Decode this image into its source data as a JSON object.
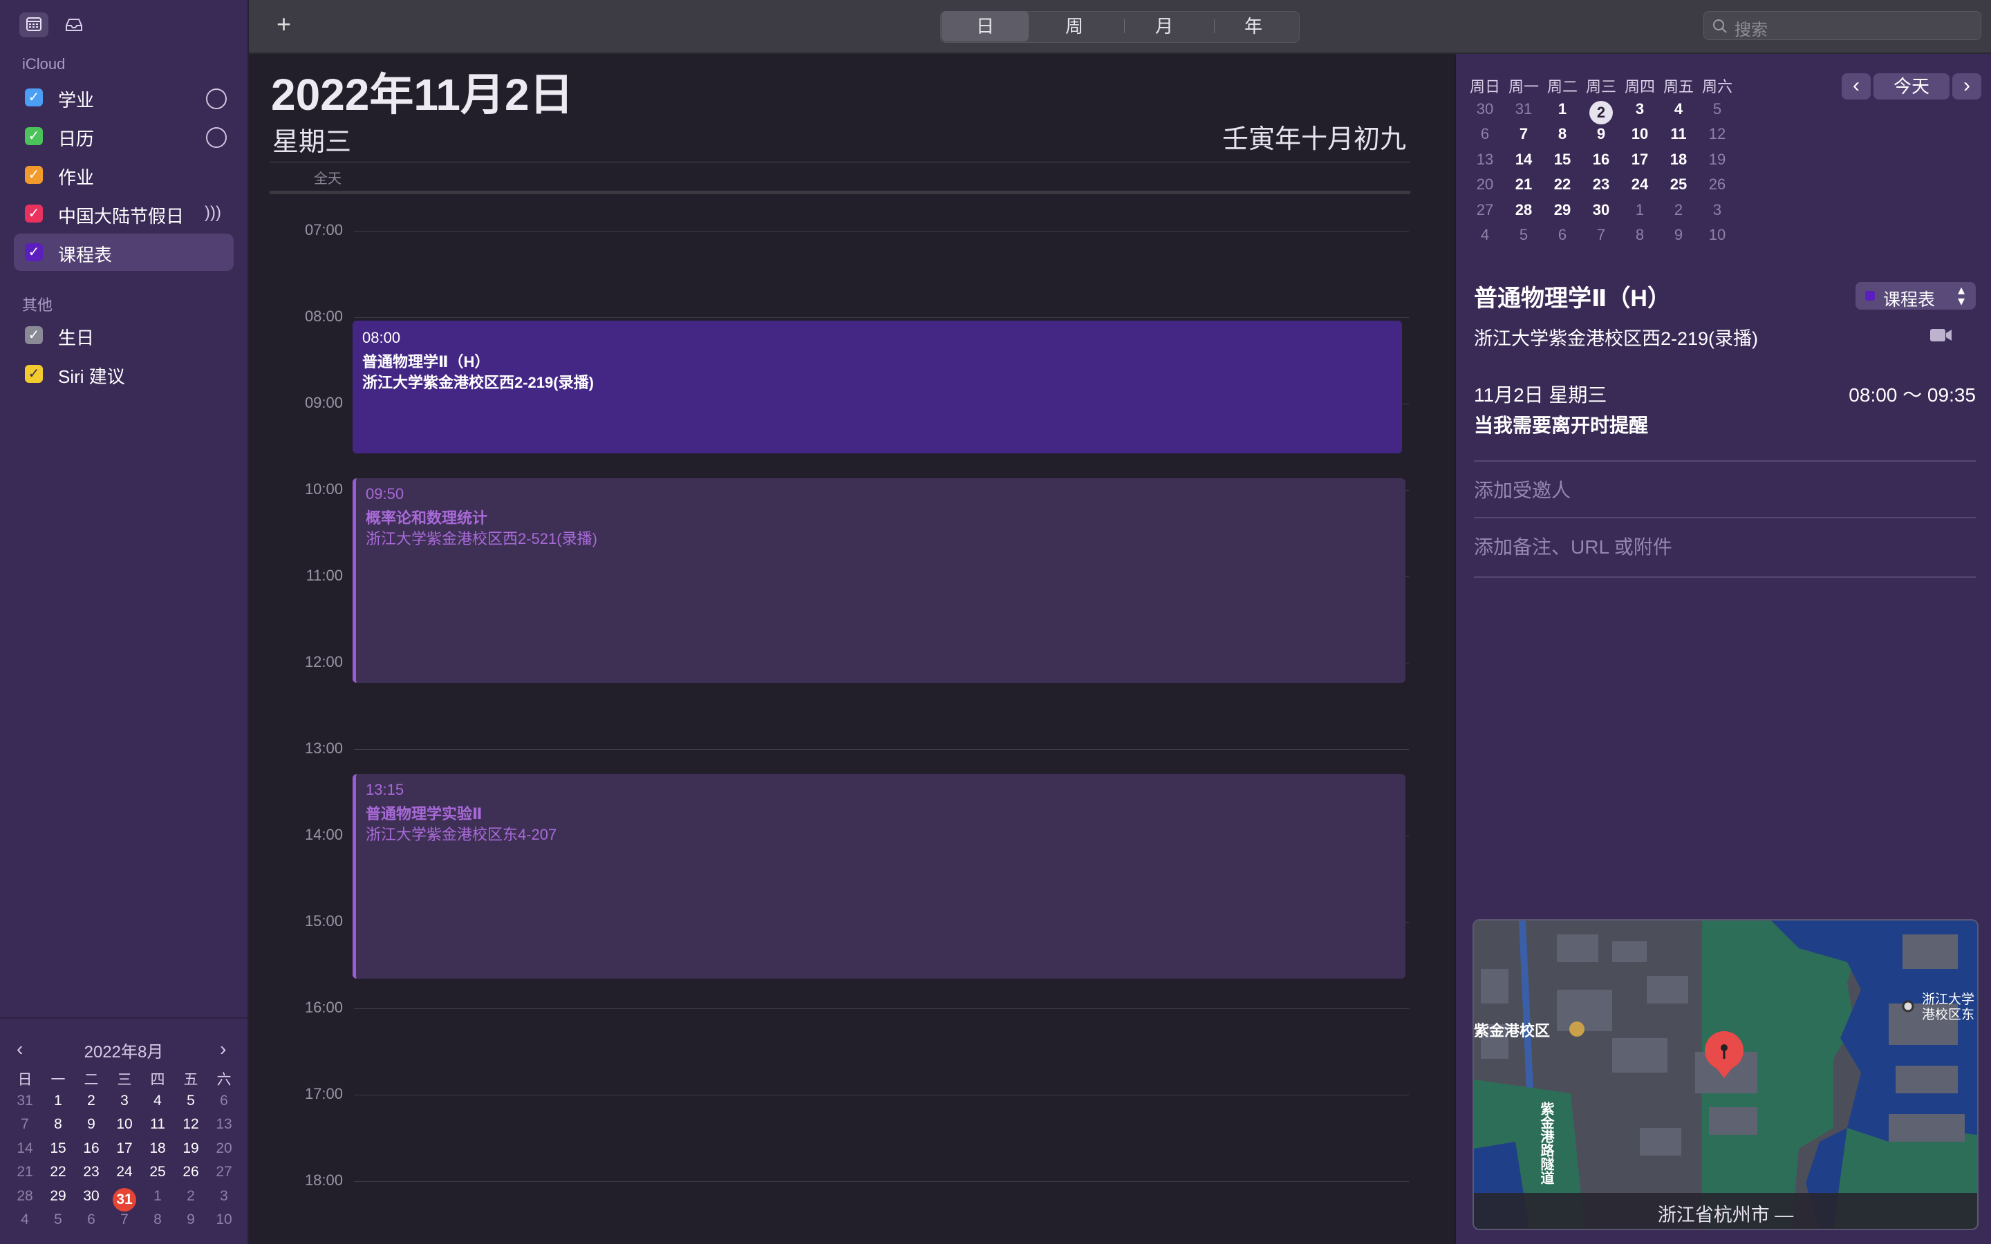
{
  "sidebar": {
    "icloud_header": "iCloud",
    "other_header": "其他",
    "calendars": [
      {
        "label": "学业",
        "color": "#4a9ff5",
        "shared": true
      },
      {
        "label": "日历",
        "color": "#4cc35a",
        "shared": true
      },
      {
        "label": "作业",
        "color": "#f39a2c",
        "shared": false
      },
      {
        "label": "中国大陆节假日",
        "color": "#e9325d",
        "shared": false,
        "subscribed": true
      },
      {
        "label": "课程表",
        "color": "#5b1fbd",
        "shared": false,
        "selected": true
      }
    ],
    "others": [
      {
        "label": "生日",
        "color": "#8a8a96"
      },
      {
        "label": "Siri 建议",
        "color": "#f2cb2e"
      }
    ],
    "mini_calendar": {
      "title": "2022年8月",
      "weekdays": [
        "日",
        "一",
        "二",
        "三",
        "四",
        "五",
        "六"
      ],
      "days": [
        "31",
        "1",
        "2",
        "3",
        "4",
        "5",
        "6",
        "7",
        "8",
        "9",
        "10",
        "11",
        "12",
        "13",
        "14",
        "15",
        "16",
        "17",
        "18",
        "19",
        "20",
        "21",
        "22",
        "23",
        "24",
        "25",
        "26",
        "27",
        "28",
        "29",
        "30",
        "31",
        "1",
        "2",
        "3",
        "4",
        "5",
        "6",
        "7",
        "8",
        "9",
        "10"
      ],
      "today": "31"
    }
  },
  "toolbar": {
    "add_label": "+",
    "views": [
      "日",
      "周",
      "月",
      "年"
    ],
    "active_view": "日",
    "search_placeholder": "搜索"
  },
  "day_view": {
    "date_title": "2022年11月2日",
    "weekday": "星期三",
    "lunar_date": "壬寅年十月初九",
    "all_day_label": "全天",
    "hours": [
      "07:00",
      "08:00",
      "09:00",
      "10:00",
      "11:00",
      "12:00",
      "13:00",
      "14:00",
      "15:00",
      "16:00",
      "17:00",
      "18:00"
    ],
    "events": [
      {
        "time": "08:00",
        "title": "普通物理学Ⅱ（H）",
        "location": "浙江大学紫金港校区西2-219(录播)",
        "selected": true
      },
      {
        "time": "09:50",
        "title": "概率论和数理统计",
        "location": "浙江大学紫金港校区西2-521(录播)",
        "selected": false
      },
      {
        "time": "13:15",
        "title": "普通物理学实验Ⅱ",
        "location": "浙江大学紫金港校区东4-207",
        "selected": false
      }
    ]
  },
  "inspector": {
    "mini_calendar": {
      "weekdays": [
        "周日",
        "周一",
        "周二",
        "周三",
        "周四",
        "周五",
        "周六"
      ],
      "days": [
        "30",
        "31",
        "1",
        "2",
        "3",
        "4",
        "5",
        "6",
        "7",
        "8",
        "9",
        "10",
        "11",
        "12",
        "13",
        "14",
        "15",
        "16",
        "17",
        "18",
        "19",
        "20",
        "21",
        "22",
        "23",
        "24",
        "25",
        "26",
        "27",
        "28",
        "29",
        "30",
        "1",
        "2",
        "3",
        "4",
        "5",
        "6",
        "7",
        "8",
        "9",
        "10"
      ],
      "selected_day": "2",
      "today_button": "今天"
    },
    "event_title": "普通物理学Ⅱ（H）",
    "calendar_label": "课程表",
    "location": "浙江大学紫金港校区西2-219(录播)",
    "date": "11月2日 星期三",
    "time_range": "08:00 ～ 09:35",
    "alert": "当我需要离开时提醒",
    "add_invitees": "添加受邀人",
    "add_notes": "添加备注、URL 或附件",
    "map": {
      "label_campus": "紫金港校区",
      "label_road": "紫金港路隧道",
      "label_poi": "浙江大学\n港校区东",
      "footer": "浙江省杭州市 —"
    }
  }
}
